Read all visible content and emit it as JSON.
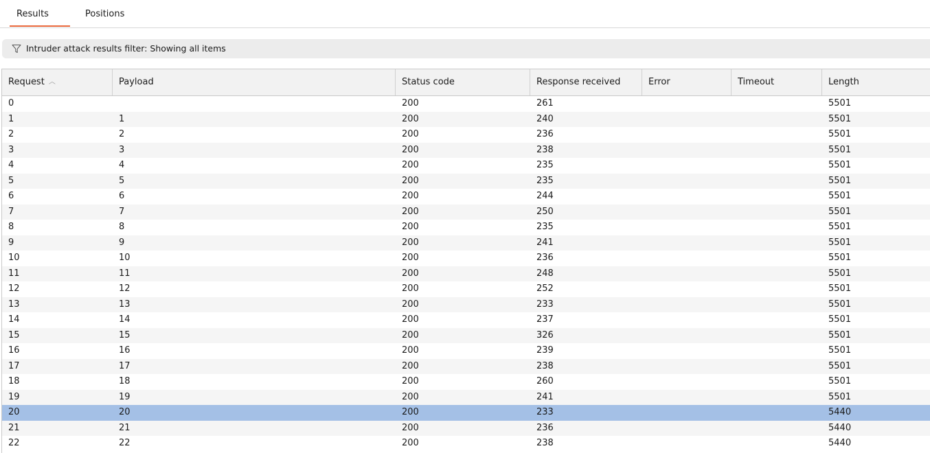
{
  "tabs": [
    {
      "label": "Results",
      "active": true
    },
    {
      "label": "Positions",
      "active": false
    }
  ],
  "filter": {
    "icon": "filter-icon",
    "text": "Intruder attack results filter: Showing all items"
  },
  "table": {
    "columns": [
      "Request",
      "Payload",
      "Status code",
      "Response received",
      "Error",
      "Timeout",
      "Length"
    ],
    "sort_column": "Request",
    "sort_direction": "ascending",
    "selected_row": 20,
    "rows": [
      {
        "request": "0",
        "payload": "",
        "status": "200",
        "response": "261",
        "error": "",
        "timeout": "",
        "length": "5501"
      },
      {
        "request": "1",
        "payload": "1",
        "status": "200",
        "response": "240",
        "error": "",
        "timeout": "",
        "length": "5501"
      },
      {
        "request": "2",
        "payload": "2",
        "status": "200",
        "response": "236",
        "error": "",
        "timeout": "",
        "length": "5501"
      },
      {
        "request": "3",
        "payload": "3",
        "status": "200",
        "response": "238",
        "error": "",
        "timeout": "",
        "length": "5501"
      },
      {
        "request": "4",
        "payload": "4",
        "status": "200",
        "response": "235",
        "error": "",
        "timeout": "",
        "length": "5501"
      },
      {
        "request": "5",
        "payload": "5",
        "status": "200",
        "response": "235",
        "error": "",
        "timeout": "",
        "length": "5501"
      },
      {
        "request": "6",
        "payload": "6",
        "status": "200",
        "response": "244",
        "error": "",
        "timeout": "",
        "length": "5501"
      },
      {
        "request": "7",
        "payload": "7",
        "status": "200",
        "response": "250",
        "error": "",
        "timeout": "",
        "length": "5501"
      },
      {
        "request": "8",
        "payload": "8",
        "status": "200",
        "response": "235",
        "error": "",
        "timeout": "",
        "length": "5501"
      },
      {
        "request": "9",
        "payload": "9",
        "status": "200",
        "response": "241",
        "error": "",
        "timeout": "",
        "length": "5501"
      },
      {
        "request": "10",
        "payload": "10",
        "status": "200",
        "response": "236",
        "error": "",
        "timeout": "",
        "length": "5501"
      },
      {
        "request": "11",
        "payload": "11",
        "status": "200",
        "response": "248",
        "error": "",
        "timeout": "",
        "length": "5501"
      },
      {
        "request": "12",
        "payload": "12",
        "status": "200",
        "response": "252",
        "error": "",
        "timeout": "",
        "length": "5501"
      },
      {
        "request": "13",
        "payload": "13",
        "status": "200",
        "response": "233",
        "error": "",
        "timeout": "",
        "length": "5501"
      },
      {
        "request": "14",
        "payload": "14",
        "status": "200",
        "response": "237",
        "error": "",
        "timeout": "",
        "length": "5501"
      },
      {
        "request": "15",
        "payload": "15",
        "status": "200",
        "response": "326",
        "error": "",
        "timeout": "",
        "length": "5501"
      },
      {
        "request": "16",
        "payload": "16",
        "status": "200",
        "response": "239",
        "error": "",
        "timeout": "",
        "length": "5501"
      },
      {
        "request": "17",
        "payload": "17",
        "status": "200",
        "response": "238",
        "error": "",
        "timeout": "",
        "length": "5501"
      },
      {
        "request": "18",
        "payload": "18",
        "status": "200",
        "response": "260",
        "error": "",
        "timeout": "",
        "length": "5501"
      },
      {
        "request": "19",
        "payload": "19",
        "status": "200",
        "response": "241",
        "error": "",
        "timeout": "",
        "length": "5501"
      },
      {
        "request": "20",
        "payload": "20",
        "status": "200",
        "response": "233",
        "error": "",
        "timeout": "",
        "length": "5440"
      },
      {
        "request": "21",
        "payload": "21",
        "status": "200",
        "response": "236",
        "error": "",
        "timeout": "",
        "length": "5440"
      },
      {
        "request": "22",
        "payload": "22",
        "status": "200",
        "response": "238",
        "error": "",
        "timeout": "",
        "length": "5440"
      }
    ]
  },
  "colors": {
    "accent_tab_underline": "#e8663a",
    "selected_row": "#a4c0e6",
    "alt_row": "#f5f5f5",
    "header_bg": "#f2f2f2",
    "filter_bg": "#ececec"
  }
}
